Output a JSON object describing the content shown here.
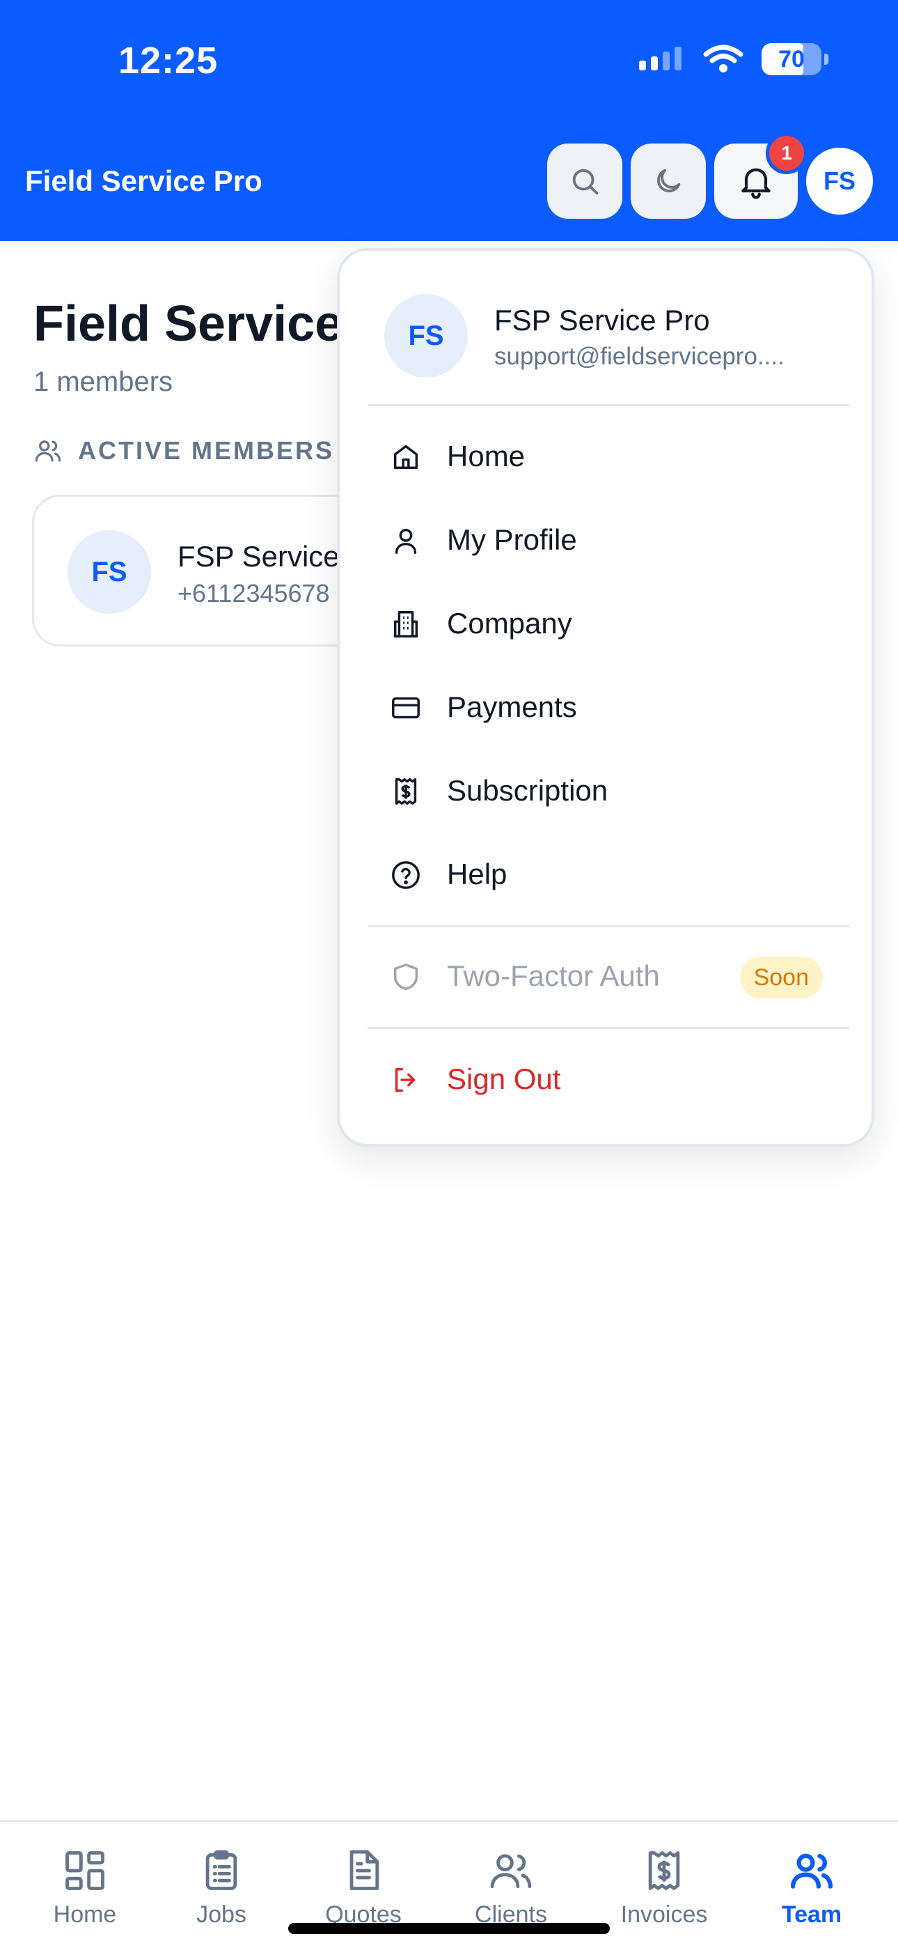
{
  "status_bar": {
    "time": "12:25",
    "battery_percent": 70,
    "battery_label": "70"
  },
  "header": {
    "title": "Field Service Pro",
    "notification_count": "1",
    "avatar_initials": "FS"
  },
  "page": {
    "title": "Field Service",
    "member_count": "1 members",
    "section_label": "ACTIVE MEMBERS",
    "members": [
      {
        "initials": "FS",
        "name": "FSP Service",
        "phone": "+6112345678"
      }
    ]
  },
  "dropdown": {
    "user": {
      "initials": "FS",
      "name": "FSP Service Pro",
      "email": "support@fieldservicepro...."
    },
    "items": [
      {
        "label": "Home",
        "icon": "home-icon"
      },
      {
        "label": "My Profile",
        "icon": "user-icon"
      },
      {
        "label": "Company",
        "icon": "building-icon"
      },
      {
        "label": "Payments",
        "icon": "credit-card-icon"
      },
      {
        "label": "Subscription",
        "icon": "receipt-icon"
      },
      {
        "label": "Help",
        "icon": "help-circle-icon"
      }
    ],
    "two_factor": {
      "label": "Two-Factor Auth",
      "badge": "Soon",
      "icon": "shield-icon"
    },
    "sign_out": {
      "label": "Sign Out",
      "icon": "log-out-icon"
    }
  },
  "bottom_nav": {
    "items": [
      {
        "label": "Home",
        "icon": "grid-icon"
      },
      {
        "label": "Jobs",
        "icon": "clipboard-icon"
      },
      {
        "label": "Quotes",
        "icon": "file-text-icon"
      },
      {
        "label": "Clients",
        "icon": "users-icon"
      },
      {
        "label": "Invoices",
        "icon": "receipt-icon"
      },
      {
        "label": "Team",
        "icon": "team-icon",
        "active": true
      }
    ]
  },
  "colors": {
    "brand": "#0a5cff",
    "danger": "#dc2626",
    "badge": "#ef4444",
    "soon_bg": "#fef3c7",
    "soon_text": "#d97706"
  }
}
